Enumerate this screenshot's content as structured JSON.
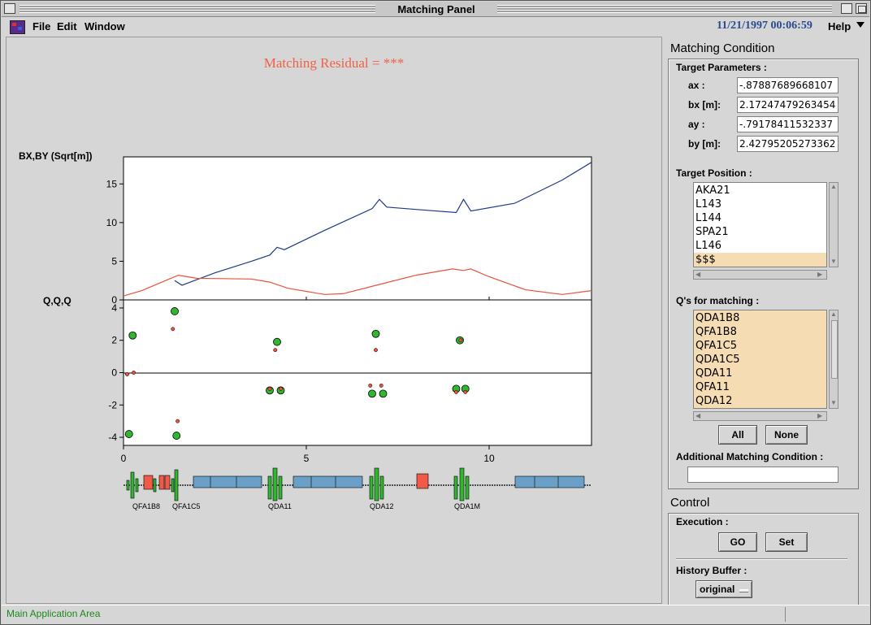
{
  "window": {
    "title": "Matching Panel"
  },
  "menu": {
    "file": "File",
    "edit": "Edit",
    "window": "Window",
    "help": "Help",
    "datetime": "11/21/1997 00:06:59"
  },
  "main": {
    "residual": "Matching Residual = ***"
  },
  "plot": {
    "top_ylabel": "BX,BY (Sqrt[m])",
    "bottom_ylabel": "Q,Q,Q",
    "x_ticks": [
      "0",
      "5",
      "10"
    ],
    "top_yticks": [
      "15",
      "10",
      "5",
      "0"
    ],
    "bottom_yticks": [
      "4",
      "2",
      "0",
      "-2",
      "-4"
    ],
    "element_labels": [
      "QFA1B8",
      "QFA1C5",
      "QDA11",
      "QDA12",
      "QDA1M"
    ],
    "colors": {
      "bx": "#1f3a8a",
      "by": "#e8523c",
      "quad": "#2fb82f",
      "bend": "#6aa0c8",
      "kicker": "#f05a47"
    }
  },
  "chart_data": [
    {
      "type": "line",
      "title": "",
      "ylabel": "BX,BY (Sqrt[m])",
      "xlim": [
        0,
        12.8
      ],
      "ylim": [
        0,
        18.5
      ],
      "series": [
        {
          "x": [
            1.4,
            1.6,
            2.5,
            3.5,
            4.0,
            4.2,
            4.4,
            5.5,
            6.8,
            7.0,
            7.2,
            8.0,
            9.1,
            9.3,
            9.5,
            10.7,
            12.0,
            12.8
          ],
          "y": [
            2.5,
            1.9,
            3.5,
            5.0,
            5.8,
            6.8,
            6.5,
            9.0,
            11.8,
            13.0,
            12.0,
            11.7,
            11.3,
            13.0,
            11.5,
            12.5,
            15.5,
            17.8
          ]
        },
        {
          "x": [
            0,
            0.5,
            1.0,
            1.5,
            2.0,
            3.5,
            4.0,
            4.5,
            5.5,
            6.0,
            7.0,
            8.0,
            9.0,
            9.3,
            9.5,
            10.0,
            11.0,
            12.0,
            12.8
          ],
          "y": [
            0.5,
            1.2,
            2.2,
            3.2,
            2.8,
            2.7,
            2.3,
            1.5,
            0.7,
            0.8,
            2.0,
            3.2,
            4.0,
            3.8,
            4.0,
            3.0,
            1.3,
            0.7,
            1.2
          ]
        }
      ]
    },
    {
      "type": "scatter",
      "title": "",
      "ylabel": "Q,Q,Q",
      "xlim": [
        0,
        12.8
      ],
      "ylim": [
        -4.5,
        4.5
      ],
      "series": [
        {
          "x": [
            0.15,
            0.25,
            1.4,
            1.45,
            4.0,
            4.2,
            4.3,
            6.8,
            6.9,
            7.1,
            9.1,
            9.2,
            9.35
          ],
          "y": [
            -3.8,
            2.3,
            3.8,
            -3.9,
            -1.1,
            1.9,
            -1.1,
            -1.3,
            2.4,
            -1.3,
            -1.0,
            2.0,
            -1.0
          ]
        },
        {
          "x": [
            0.1,
            0.28,
            1.35,
            1.48,
            4.0,
            4.15,
            4.3,
            6.75,
            6.9,
            7.05,
            9.1,
            9.22,
            9.35
          ],
          "y": [
            -0.1,
            0.0,
            2.7,
            -3.0,
            -1.0,
            1.4,
            -1.0,
            -0.8,
            1.4,
            -0.8,
            -1.2,
            2.0,
            -1.2
          ]
        }
      ]
    }
  ],
  "side": {
    "matching_title": "Matching Condition",
    "target_params_label": "Target Parameters :",
    "params": [
      {
        "label": "ax :",
        "value": "-.87887689668107"
      },
      {
        "label": "bx [m]:",
        "value": "2.17247479263454"
      },
      {
        "label": "ay :",
        "value": "-.79178411532337"
      },
      {
        "label": "by [m]:",
        "value": "2.42795205273362"
      }
    ],
    "target_position_label": "Target Position :",
    "positions": [
      "AKA21",
      "L143",
      "L144",
      "SPA21",
      "L146",
      "$$$"
    ],
    "qs_label": "Q's for matching :",
    "qs": [
      "QDA1B8",
      "QFA1B8",
      "QFA1C5",
      "QDA1C5",
      "QDA11",
      "QFA11",
      "QDA12"
    ],
    "all_button": "All",
    "none_button": "None",
    "additional_label": "Additional Matching Condition :",
    "additional_value": "",
    "control_title": "Control",
    "execution_label": "Execution :",
    "go_button": "GO",
    "set_button": "Set",
    "history_label": "History Buffer :",
    "history_value": "original"
  },
  "status": {
    "text": "Main Application Area"
  }
}
